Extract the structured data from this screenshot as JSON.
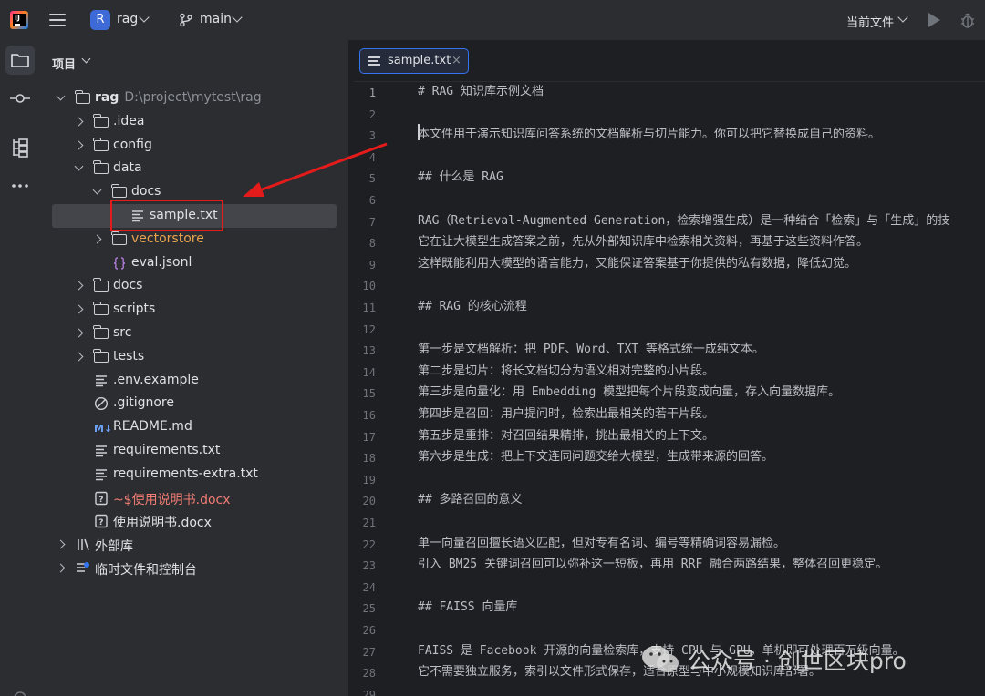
{
  "titlebar": {
    "project_badge": "R",
    "project_name": "rag",
    "branch": "main",
    "run_config": "当前文件"
  },
  "project_panel": {
    "title": "项目",
    "tree": [
      {
        "label": "rag",
        "path": "D:\\project\\mytest\\rag",
        "depth": 0,
        "expand": "open",
        "icon": "folder-icon",
        "style": "bold"
      },
      {
        "label": ".idea",
        "depth": 1,
        "expand": "closed",
        "icon": "folder-icon"
      },
      {
        "label": "config",
        "depth": 1,
        "expand": "closed",
        "icon": "folder-icon"
      },
      {
        "label": "data",
        "depth": 1,
        "expand": "open",
        "icon": "folder-icon"
      },
      {
        "label": "docs",
        "depth": 2,
        "expand": "open",
        "icon": "folder-icon"
      },
      {
        "label": "sample.txt",
        "depth": 3,
        "expand": "none",
        "icon": "text-file-icon",
        "selected": true
      },
      {
        "label": "vectorstore",
        "depth": 2,
        "expand": "closed",
        "icon": "folder-icon",
        "style": "orange"
      },
      {
        "label": "eval.jsonl",
        "depth": 2,
        "expand": "none",
        "icon": "json-file-icon"
      },
      {
        "label": "docs",
        "depth": 1,
        "expand": "closed",
        "icon": "folder-icon"
      },
      {
        "label": "scripts",
        "depth": 1,
        "expand": "closed",
        "icon": "folder-icon"
      },
      {
        "label": "src",
        "depth": 1,
        "expand": "closed",
        "icon": "folder-icon"
      },
      {
        "label": "tests",
        "depth": 1,
        "expand": "closed",
        "icon": "folder-icon"
      },
      {
        "label": ".env.example",
        "depth": 1,
        "expand": "none",
        "icon": "text-file-icon"
      },
      {
        "label": ".gitignore",
        "depth": 1,
        "expand": "none",
        "icon": "gitignore-icon"
      },
      {
        "label": "README.md",
        "depth": 1,
        "expand": "none",
        "icon": "markdown-icon"
      },
      {
        "label": "requirements.txt",
        "depth": 1,
        "expand": "none",
        "icon": "text-file-icon"
      },
      {
        "label": "requirements-extra.txt",
        "depth": 1,
        "expand": "none",
        "icon": "text-file-icon"
      },
      {
        "label": "~$使用说明书.docx",
        "depth": 1,
        "expand": "none",
        "icon": "unknown-file-icon",
        "style": "red"
      },
      {
        "label": "使用说明书.docx",
        "depth": 1,
        "expand": "none",
        "icon": "unknown-file-icon"
      },
      {
        "label": "外部库",
        "depth": 0,
        "expand": "closed",
        "icon": "library-icon"
      },
      {
        "label": "临时文件和控制台",
        "depth": 0,
        "expand": "closed",
        "icon": "scratches-icon"
      }
    ]
  },
  "editor": {
    "tab_label": "sample.txt",
    "tab_close": "×",
    "current_line": 1,
    "lines": [
      "# RAG 知识库示例文档",
      "",
      "本文件用于演示知识库问答系统的文档解析与切片能力。你可以把它替换成自己的资料。",
      "",
      "## 什么是 RAG",
      "",
      "RAG（Retrieval-Augmented Generation，检索增强生成）是一种结合「检索」与「生成」的技",
      "它在让大模型生成答案之前，先从外部知识库中检索相关资料，再基于这些资料作答。",
      "这样既能利用大模型的语言能力，又能保证答案基于你提供的私有数据，降低幻觉。",
      "",
      "## RAG 的核心流程",
      "",
      "第一步是文档解析：把 PDF、Word、TXT 等格式统一成纯文本。",
      "第二步是切片：将长文档切分为语义相对完整的小片段。",
      "第三步是向量化：用 Embedding 模型把每个片段变成向量，存入向量数据库。",
      "第四步是召回：用户提问时，检索出最相关的若干片段。",
      "第五步是重排：对召回结果精排，挑出最相关的上下文。",
      "第六步是生成：把上下文连同问题交给大模型，生成带来源的回答。",
      "",
      "## 多路召回的意义",
      "",
      "单一向量召回擅长语义匹配，但对专有名词、编号等精确词容易漏检。",
      "引入 BM25 关键词召回可以弥补这一短板，再用 RRF 融合两路结果，整体召回更稳定。",
      "",
      "## FAISS 向量库",
      "",
      "FAISS 是 Facebook 开源的向量检索库，支持 CPU 与 GPU，单机即可处理百万级向量。",
      "它不需要独立服务，索引以文件形式保存，适合原型与中小规模知识库部署。",
      ""
    ]
  },
  "watermark": {
    "text": "公众号 · 创世区块pro"
  },
  "colors": {
    "accent": "#3574f0",
    "annotation": "#e31b1b",
    "panel_bg": "#2b2d30",
    "editor_bg": "#1e1f22"
  }
}
